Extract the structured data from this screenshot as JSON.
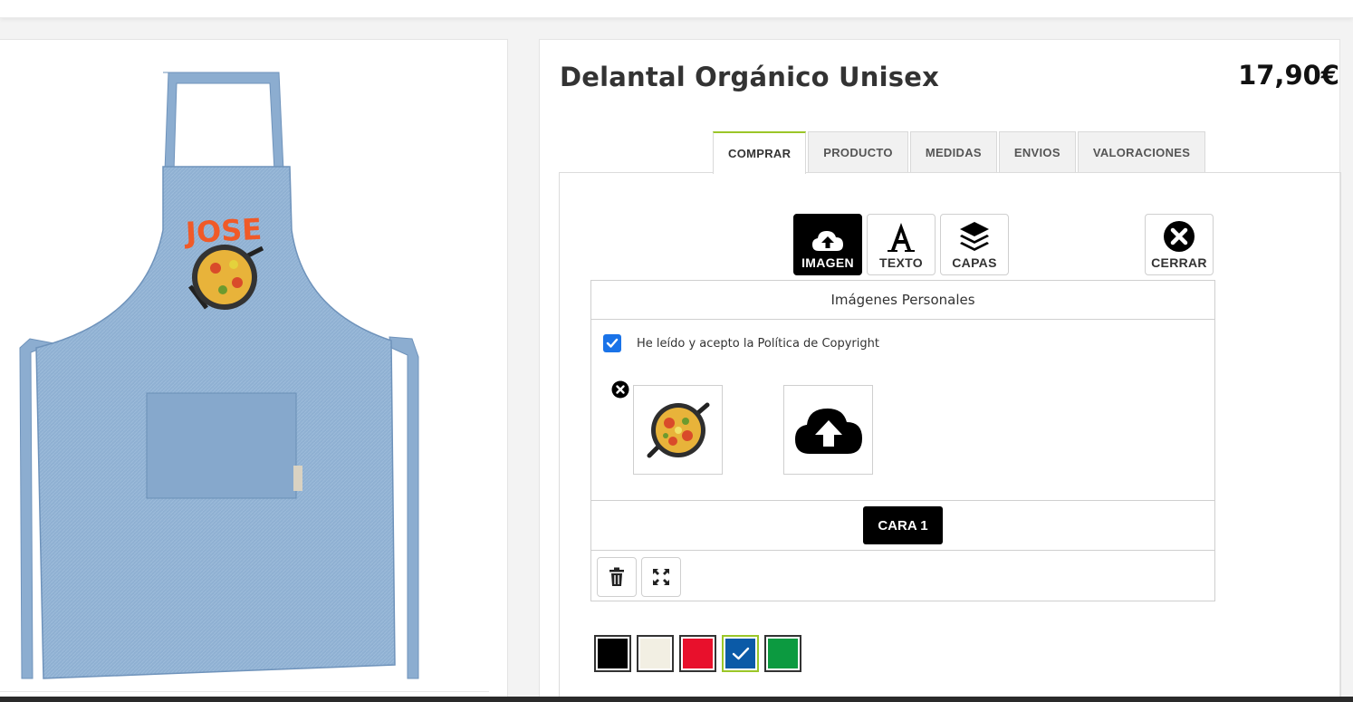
{
  "product": {
    "title": "Delantal Orgánico Unisex",
    "price": "17,90€",
    "mockup_text": "JOSE"
  },
  "tabs": [
    {
      "label": "COMPRAR",
      "active": true
    },
    {
      "label": "PRODUCTO",
      "active": false
    },
    {
      "label": "MEDIDAS",
      "active": false
    },
    {
      "label": "ENVIOS",
      "active": false
    },
    {
      "label": "VALORACIONES",
      "active": false
    }
  ],
  "toolbar": {
    "image_label": "IMAGEN",
    "text_label": "TEXTO",
    "layers_label": "CAPAS",
    "close_label": "CERRAR"
  },
  "editor": {
    "header": "Imágenes Personales",
    "copyright_label": "He leído y acepto la Política de Copyright",
    "copyright_checked": true,
    "side_label": "CARA 1"
  },
  "colors": {
    "accent": "#9bc628",
    "checkbox": "#1a73e8",
    "apron": "#8fb0d2"
  },
  "swatches": [
    {
      "name": "black",
      "hex": "#000000",
      "selected": false
    },
    {
      "name": "cream",
      "hex": "#f2efe3",
      "selected": false
    },
    {
      "name": "red",
      "hex": "#e8102c",
      "selected": false
    },
    {
      "name": "blue",
      "hex": "#0b5aa7",
      "selected": true
    },
    {
      "name": "green",
      "hex": "#0c9a40",
      "selected": false
    }
  ]
}
